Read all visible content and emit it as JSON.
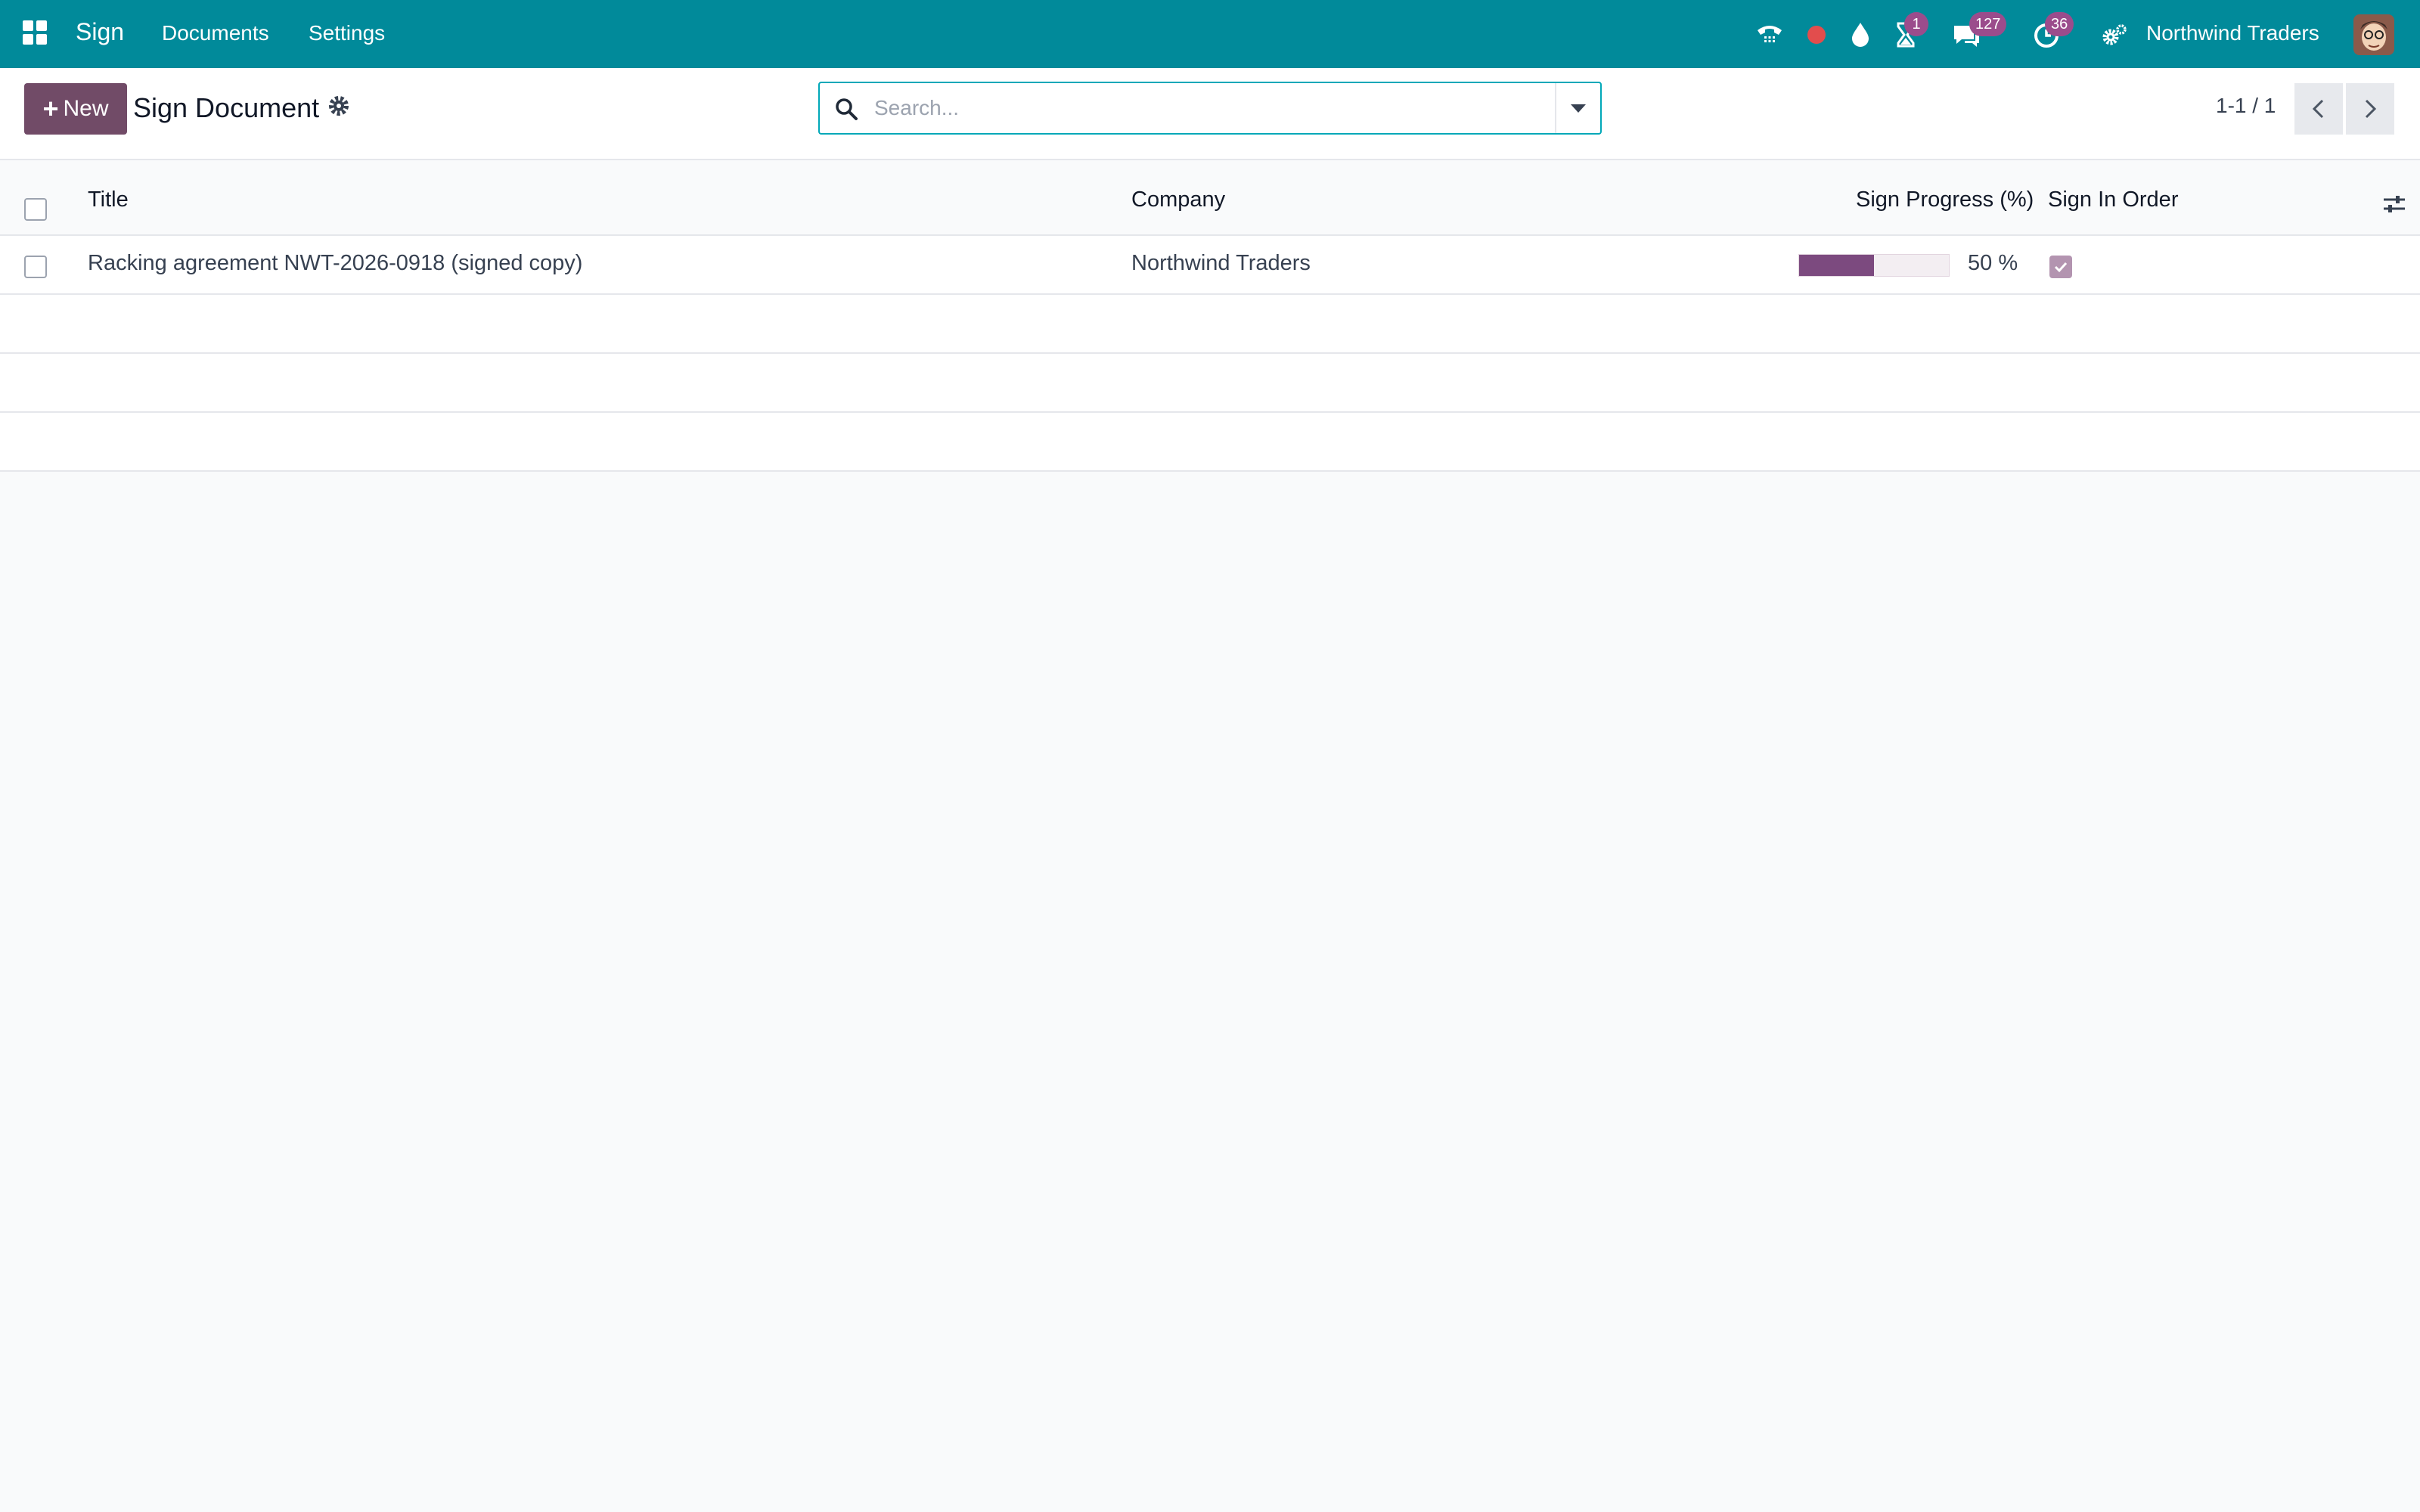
{
  "navbar": {
    "app_name": "Sign",
    "menu": [
      "Documents",
      "Settings"
    ],
    "badges": {
      "activities": "1",
      "messages": "127",
      "timesheets": "36"
    },
    "company": "Northwind Traders",
    "icons": [
      "apps-grid-icon",
      "phone-icon",
      "record-dot-icon",
      "drop-icon",
      "hourglass-icon",
      "chat-icon",
      "clock-icon",
      "settings-gears-icon"
    ],
    "colors": {
      "bar": "#018a9a",
      "badge": "#9b4c8c",
      "record_dot": "#e24d4d"
    }
  },
  "control_panel": {
    "new_label": "New",
    "title": "Sign Document",
    "search_placeholder": "Search...",
    "pager": "1-1 / 1",
    "colors": {
      "primary": "#714b67",
      "search_border": "#01a8b8"
    }
  },
  "list": {
    "columns": {
      "title": "Title",
      "company": "Company",
      "progress": "Sign Progress (%)",
      "order": "Sign In Order"
    },
    "rows": [
      {
        "title": "Racking agreement NWT-2026-0918 (signed copy)",
        "company": "Northwind Traders",
        "progress": 50,
        "progress_label": "50 %",
        "sign_in_order": true
      }
    ]
  }
}
